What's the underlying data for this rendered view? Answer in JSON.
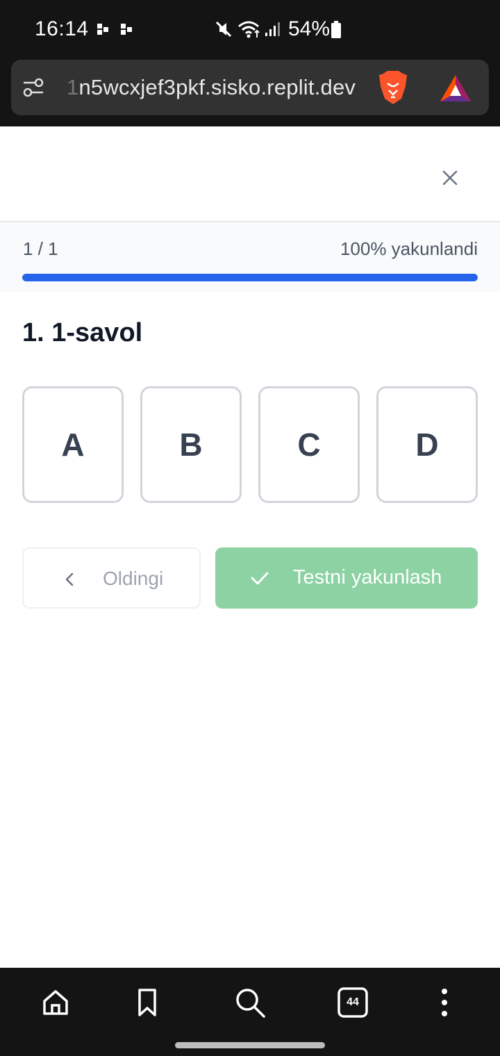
{
  "status_bar": {
    "time": "16:14",
    "battery_text": "54%",
    "icons": [
      "notification-icon",
      "notification-icon",
      "mute-icon",
      "wifi-icon",
      "signal-icon",
      "battery-icon"
    ]
  },
  "browser": {
    "url_faded": "1",
    "url_text": "n5wcxjef3pkf.sisko.replit.dev",
    "icons": [
      "tune-icon",
      "brave-lion-icon",
      "bat-triangle-icon"
    ]
  },
  "progress": {
    "count": "1 / 1",
    "label": "100% yakunlandi",
    "fraction": 1.0,
    "color": "#2563eb"
  },
  "question": {
    "title": "1. 1-savol",
    "options": [
      "A",
      "B",
      "C",
      "D"
    ]
  },
  "actions": {
    "prev_label": "Oldingi",
    "finish_label": "Testni yakunlash",
    "finish_color": "#8dd2a3"
  },
  "bottom_nav": {
    "tab_count": "44",
    "icons": [
      "home-icon",
      "bookmark-icon",
      "search-icon",
      "tabs-icon",
      "more-vertical-icon"
    ]
  }
}
